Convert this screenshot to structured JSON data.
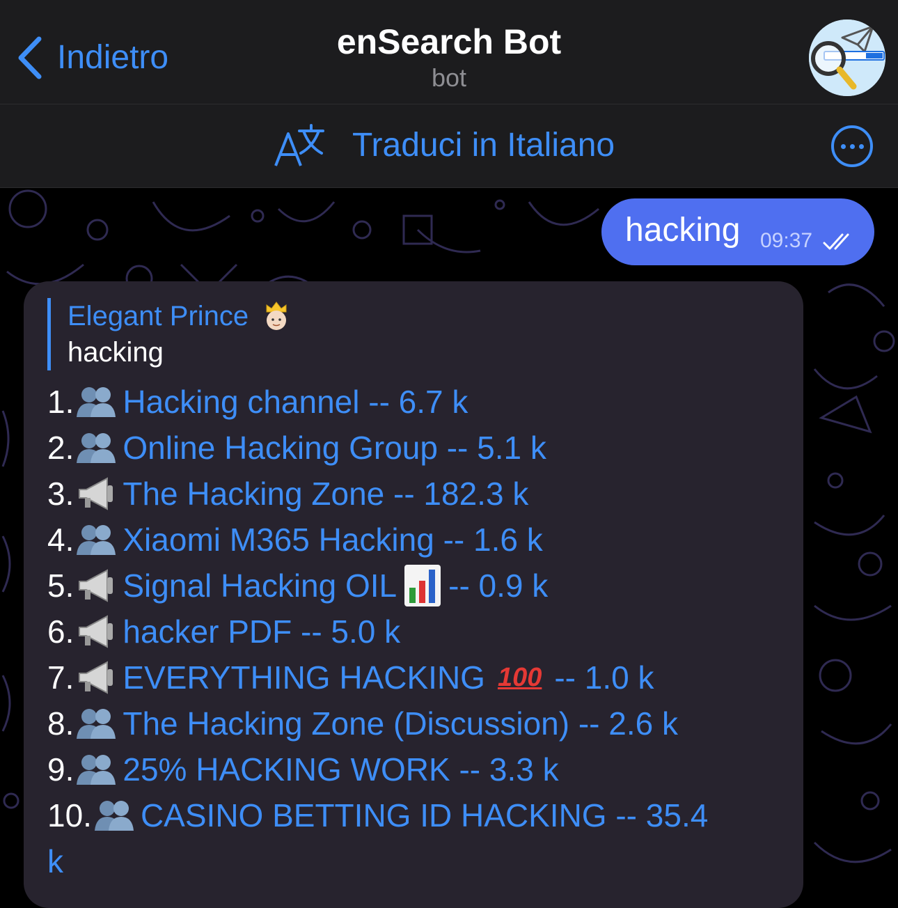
{
  "header": {
    "back_label": "Indietro",
    "title": "enSearch Bot",
    "subtitle": "bot",
    "avatar_icon": "ensearch-logo-icon"
  },
  "translate_bar": {
    "label": "Traduci in Italiano",
    "icon": "translate-icon",
    "more_icon": "more-options-icon"
  },
  "outgoing_message": {
    "text": "hacking",
    "time": "09:37",
    "status_icon": "double-check-icon"
  },
  "incoming_message": {
    "reply": {
      "sender": "Elegant Prince",
      "text": "hacking"
    },
    "results": [
      {
        "number": "1.",
        "icon": "group-icon",
        "label": "Hacking channel -- 6.7 k"
      },
      {
        "number": "2.",
        "icon": "group-icon",
        "label": "Online Hacking Group -- 5.1 k"
      },
      {
        "number": "3.",
        "icon": "megaphone-icon",
        "label": "The Hacking Zone -- 182.3 k"
      },
      {
        "number": "4.",
        "icon": "group-icon",
        "label": "Xiaomi M365 Hacking -- 1.6 k"
      },
      {
        "number": "5.",
        "icon": "megaphone-icon",
        "label": "Signal Hacking OIL",
        "suffix": "-- 0.9 k"
      },
      {
        "number": "6.",
        "icon": "megaphone-icon",
        "label": "hacker PDF -- 5.0 k"
      },
      {
        "number": "7.",
        "icon": "megaphone-icon",
        "label": "EVERYTHING HACKING",
        "suffix": "-- 1.0 k",
        "emoji": "100"
      },
      {
        "number": "8.",
        "icon": "group-icon",
        "label": "The Hacking Zone (Discussion) -- 2.6 k"
      },
      {
        "number": "9.",
        "icon": "group-icon",
        "label": "25% HACKING WORK -- 3.3 k"
      },
      {
        "number": "10.",
        "icon": "group-icon",
        "label": "CASINO BETTING ID HACKING -- 35.4",
        "continuation": "k"
      }
    ]
  },
  "colors": {
    "accent": "#3e8ef7",
    "outgoing_bubble": "#4f6ff0",
    "incoming_bubble": "#27232e",
    "header_bg": "#1c1c1e"
  }
}
